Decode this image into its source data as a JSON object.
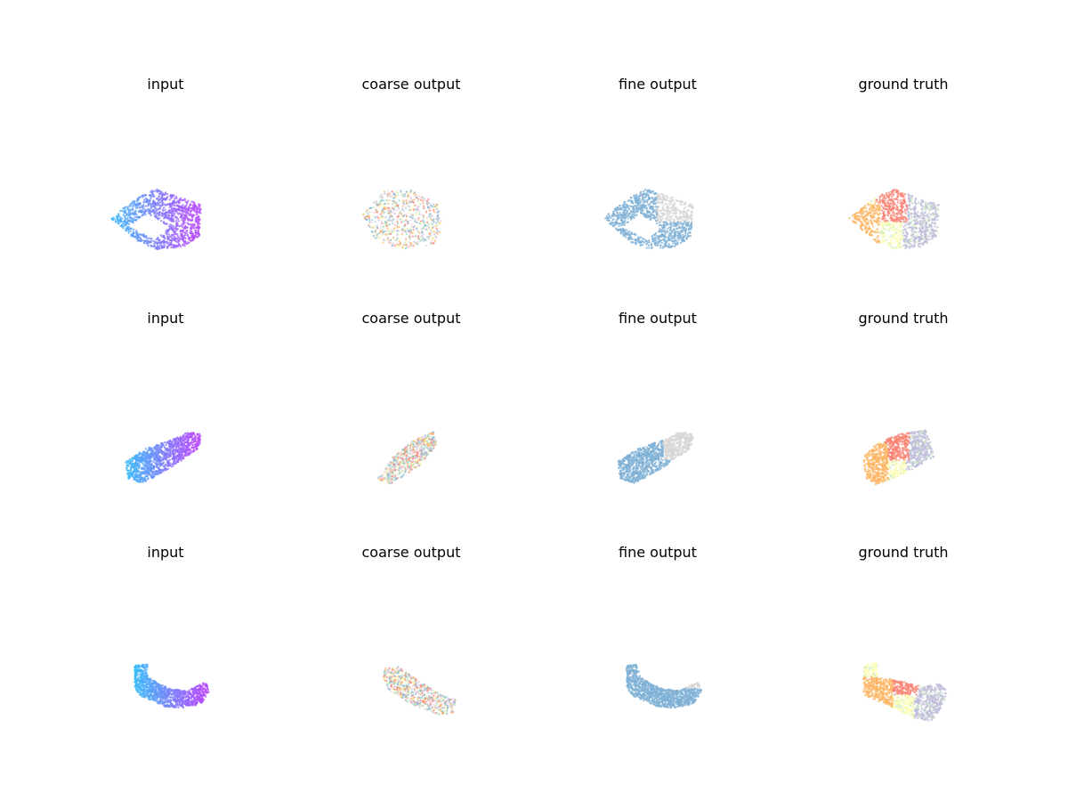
{
  "figure": {
    "rows": [
      {
        "panels": [
          {
            "title": "input",
            "colormap": "gradient",
            "shape": "hexagon_notched"
          },
          {
            "title": "coarse output",
            "colormap": "mixed",
            "shape": "blob"
          },
          {
            "title": "fine output",
            "colormap": "blue_gray",
            "shape": "hexagon_notched"
          },
          {
            "title": "ground truth",
            "colormap": "segments",
            "shape": "hexagon"
          }
        ]
      },
      {
        "panels": [
          {
            "title": "input",
            "colormap": "gradient",
            "shape": "slab"
          },
          {
            "title": "coarse output",
            "colormap": "mixed",
            "shape": "slab_thin"
          },
          {
            "title": "fine output",
            "colormap": "blue_gray",
            "shape": "slab"
          },
          {
            "title": "ground truth",
            "colormap": "segments",
            "shape": "box"
          }
        ]
      },
      {
        "panels": [
          {
            "title": "input",
            "colormap": "gradient",
            "shape": "lshape"
          },
          {
            "title": "coarse output",
            "colormap": "mixed",
            "shape": "lshape_thin"
          },
          {
            "title": "fine output",
            "colormap": "blue_gray",
            "shape": "lshape"
          },
          {
            "title": "ground truth",
            "colormap": "segments",
            "shape": "lbox"
          }
        ]
      }
    ],
    "colors": {
      "gradient_start": "#38bdf8",
      "gradient_end": "#b44cfd",
      "blue": "#7fb0d6",
      "gray": "#d6d6d6",
      "purple": "#b07ad9",
      "salmon": "#fa8072",
      "orange": "#fdb462",
      "yellow": "#ffffb3",
      "lavender": "#bebada",
      "lightgreen": "#ccebc5",
      "pink": "#fccde5",
      "teal": "#8dd3c7"
    }
  }
}
